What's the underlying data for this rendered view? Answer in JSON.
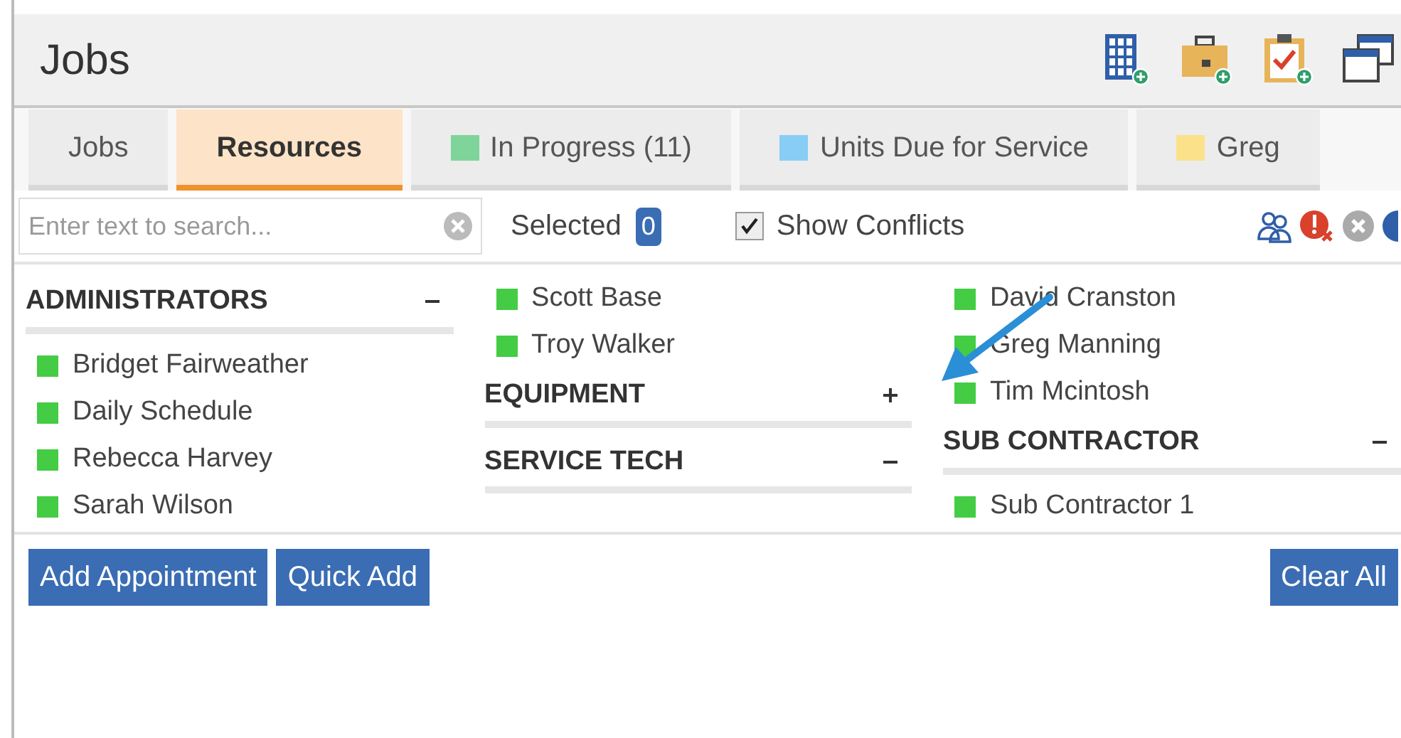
{
  "window": {
    "title": "Jobs"
  },
  "tabs": [
    {
      "label": "Jobs",
      "selected": false
    },
    {
      "label": "Resources",
      "selected": true
    },
    {
      "label": "In Progress (11)",
      "selected": false,
      "color": "#7fd49a"
    },
    {
      "label": "Units Due for Service",
      "selected": false,
      "color": "#87cdf5"
    },
    {
      "label": "Greg",
      "selected": false,
      "color": "#fbe18a"
    }
  ],
  "search": {
    "placeholder": "Enter text to search..."
  },
  "selected": {
    "label": "Selected",
    "count": "0"
  },
  "show_conflicts": {
    "label": "Show Conflicts",
    "checked": true
  },
  "columns": [
    [
      {
        "kind": "header",
        "label": "ADMINISTRATORS",
        "expanded": true
      },
      {
        "kind": "resource",
        "label": "Bridget Fairweather",
        "color": "#44cc44"
      },
      {
        "kind": "resource",
        "label": "Daily Schedule",
        "color": "#44cc44"
      },
      {
        "kind": "resource",
        "label": "Rebecca Harvey",
        "color": "#44cc44"
      },
      {
        "kind": "resource",
        "label": "Sarah Wilson",
        "color": "#44cc44"
      }
    ],
    [
      {
        "kind": "resource",
        "label": "Scott Base",
        "color": "#44cc44"
      },
      {
        "kind": "resource",
        "label": "Troy Walker",
        "color": "#44cc44"
      },
      {
        "kind": "header",
        "label": "EQUIPMENT",
        "expanded": false
      },
      {
        "kind": "header",
        "label": "SERVICE TECH",
        "expanded": true
      }
    ],
    [
      {
        "kind": "resource",
        "label": "David Cranston",
        "color": "#44cc44"
      },
      {
        "kind": "resource",
        "label": "Greg Manning",
        "color": "#44cc44"
      },
      {
        "kind": "resource",
        "label": "Tim Mcintosh",
        "color": "#44cc44"
      },
      {
        "kind": "header",
        "label": "SUB CONTRACTOR",
        "expanded": true
      },
      {
        "kind": "resource",
        "label": "Sub Contractor 1",
        "color": "#44cc44"
      }
    ]
  ],
  "buttons": [
    "Add Appointment",
    "Quick Add"
  ],
  "clear_button": "Clear All"
}
